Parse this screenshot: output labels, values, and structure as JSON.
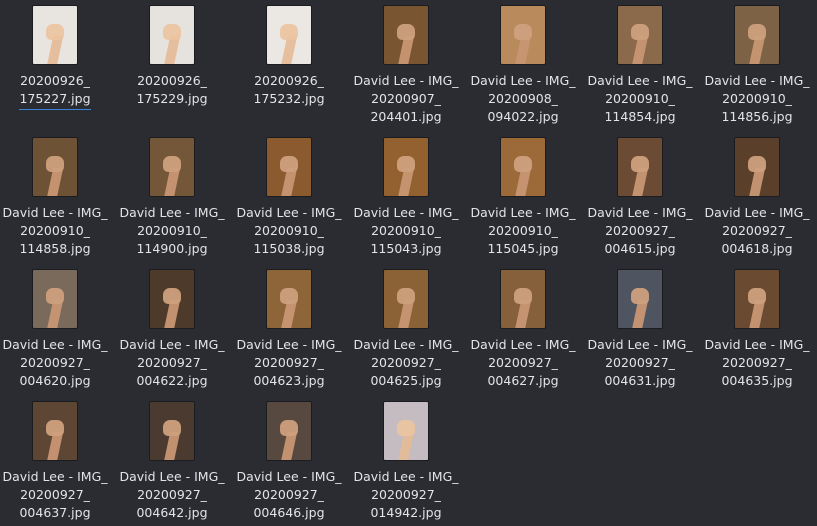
{
  "files": [
    {
      "lines": [
        "20200926_",
        "175227.jpg"
      ],
      "bg": "#e8e4e0",
      "selected": true,
      "photo": false
    },
    {
      "lines": [
        "20200926_",
        "175229.jpg"
      ],
      "bg": "#e6e2de",
      "selected": false,
      "photo": false
    },
    {
      "lines": [
        "20200926_",
        "175232.jpg"
      ],
      "bg": "#ebe7e3",
      "selected": false,
      "photo": false
    },
    {
      "lines": [
        "David Lee - IMG_",
        "20200907_",
        "204401.jpg"
      ],
      "bg": "#7a5532",
      "selected": false,
      "photo": true
    },
    {
      "lines": [
        "David Lee - IMG_",
        "20200908_",
        "094022.jpg"
      ],
      "bg": "#b98a5c",
      "selected": false,
      "photo": true
    },
    {
      "lines": [
        "David Lee - IMG_",
        "20200910_",
        "114854.jpg"
      ],
      "bg": "#8a6a4a",
      "selected": false,
      "photo": true
    },
    {
      "lines": [
        "David Lee - IMG_",
        "20200910_",
        "114856.jpg"
      ],
      "bg": "#7e6246",
      "selected": false,
      "photo": true
    },
    {
      "lines": [
        "David Lee - IMG_",
        "20200910_",
        "114858.jpg"
      ],
      "bg": "#6e5236",
      "selected": false,
      "photo": true
    },
    {
      "lines": [
        "David Lee - IMG_",
        "20200910_",
        "114900.jpg"
      ],
      "bg": "#745739",
      "selected": false,
      "photo": true
    },
    {
      "lines": [
        "David Lee - IMG_",
        "20200910_",
        "115038.jpg"
      ],
      "bg": "#8b5a2f",
      "selected": false,
      "photo": true
    },
    {
      "lines": [
        "David Lee - IMG_",
        "20200910_",
        "115043.jpg"
      ],
      "bg": "#93612f",
      "selected": false,
      "photo": true
    },
    {
      "lines": [
        "David Lee - IMG_",
        "20200910_",
        "115045.jpg"
      ],
      "bg": "#9c6a38",
      "selected": false,
      "photo": true
    },
    {
      "lines": [
        "David Lee - IMG_",
        "20200927_",
        "004615.jpg"
      ],
      "bg": "#6b4b34",
      "selected": false,
      "photo": true
    },
    {
      "lines": [
        "David Lee - IMG_",
        "20200927_",
        "004618.jpg"
      ],
      "bg": "#5a3f2b",
      "selected": false,
      "photo": true
    },
    {
      "lines": [
        "David Lee - IMG_",
        "20200927_",
        "004620.jpg"
      ],
      "bg": "#7a6a5c",
      "selected": false,
      "photo": true
    },
    {
      "lines": [
        "David Lee - IMG_",
        "20200927_",
        "004622.jpg"
      ],
      "bg": "#4e3a2a",
      "selected": false,
      "photo": true
    },
    {
      "lines": [
        "David Lee - IMG_",
        "20200927_",
        "004623.jpg"
      ],
      "bg": "#8e6538",
      "selected": false,
      "photo": true
    },
    {
      "lines": [
        "David Lee - IMG_",
        "20200927_",
        "004625.jpg"
      ],
      "bg": "#8a6236",
      "selected": false,
      "photo": true
    },
    {
      "lines": [
        "David Lee - IMG_",
        "20200927_",
        "004627.jpg"
      ],
      "bg": "#86603a",
      "selected": false,
      "photo": true
    },
    {
      "lines": [
        "David Lee - IMG_",
        "20200927_",
        "004631.jpg"
      ],
      "bg": "#4f5560",
      "selected": false,
      "photo": true
    },
    {
      "lines": [
        "David Lee - IMG_",
        "20200927_",
        "004635.jpg"
      ],
      "bg": "#6a4a30",
      "selected": false,
      "photo": true
    },
    {
      "lines": [
        "David Lee - IMG_",
        "20200927_",
        "004637.jpg"
      ],
      "bg": "#5e4634",
      "selected": false,
      "photo": true
    },
    {
      "lines": [
        "David Lee - IMG_",
        "20200927_",
        "004642.jpg"
      ],
      "bg": "#4a3a30",
      "selected": false,
      "photo": true
    },
    {
      "lines": [
        "David Lee - IMG_",
        "20200927_",
        "004646.jpg"
      ],
      "bg": "#574840",
      "selected": false,
      "photo": true
    },
    {
      "lines": [
        "David Lee - IMG_",
        "20200927_",
        "014942.jpg"
      ],
      "bg": "#c4bcc0",
      "selected": false,
      "photo": false
    }
  ],
  "colors": {
    "background": "#2a2c31",
    "text": "#e3e4e6",
    "selection_underline": "#3b83d9"
  },
  "icons": {
    "thumbnail": "image-thumbnail-icon"
  }
}
